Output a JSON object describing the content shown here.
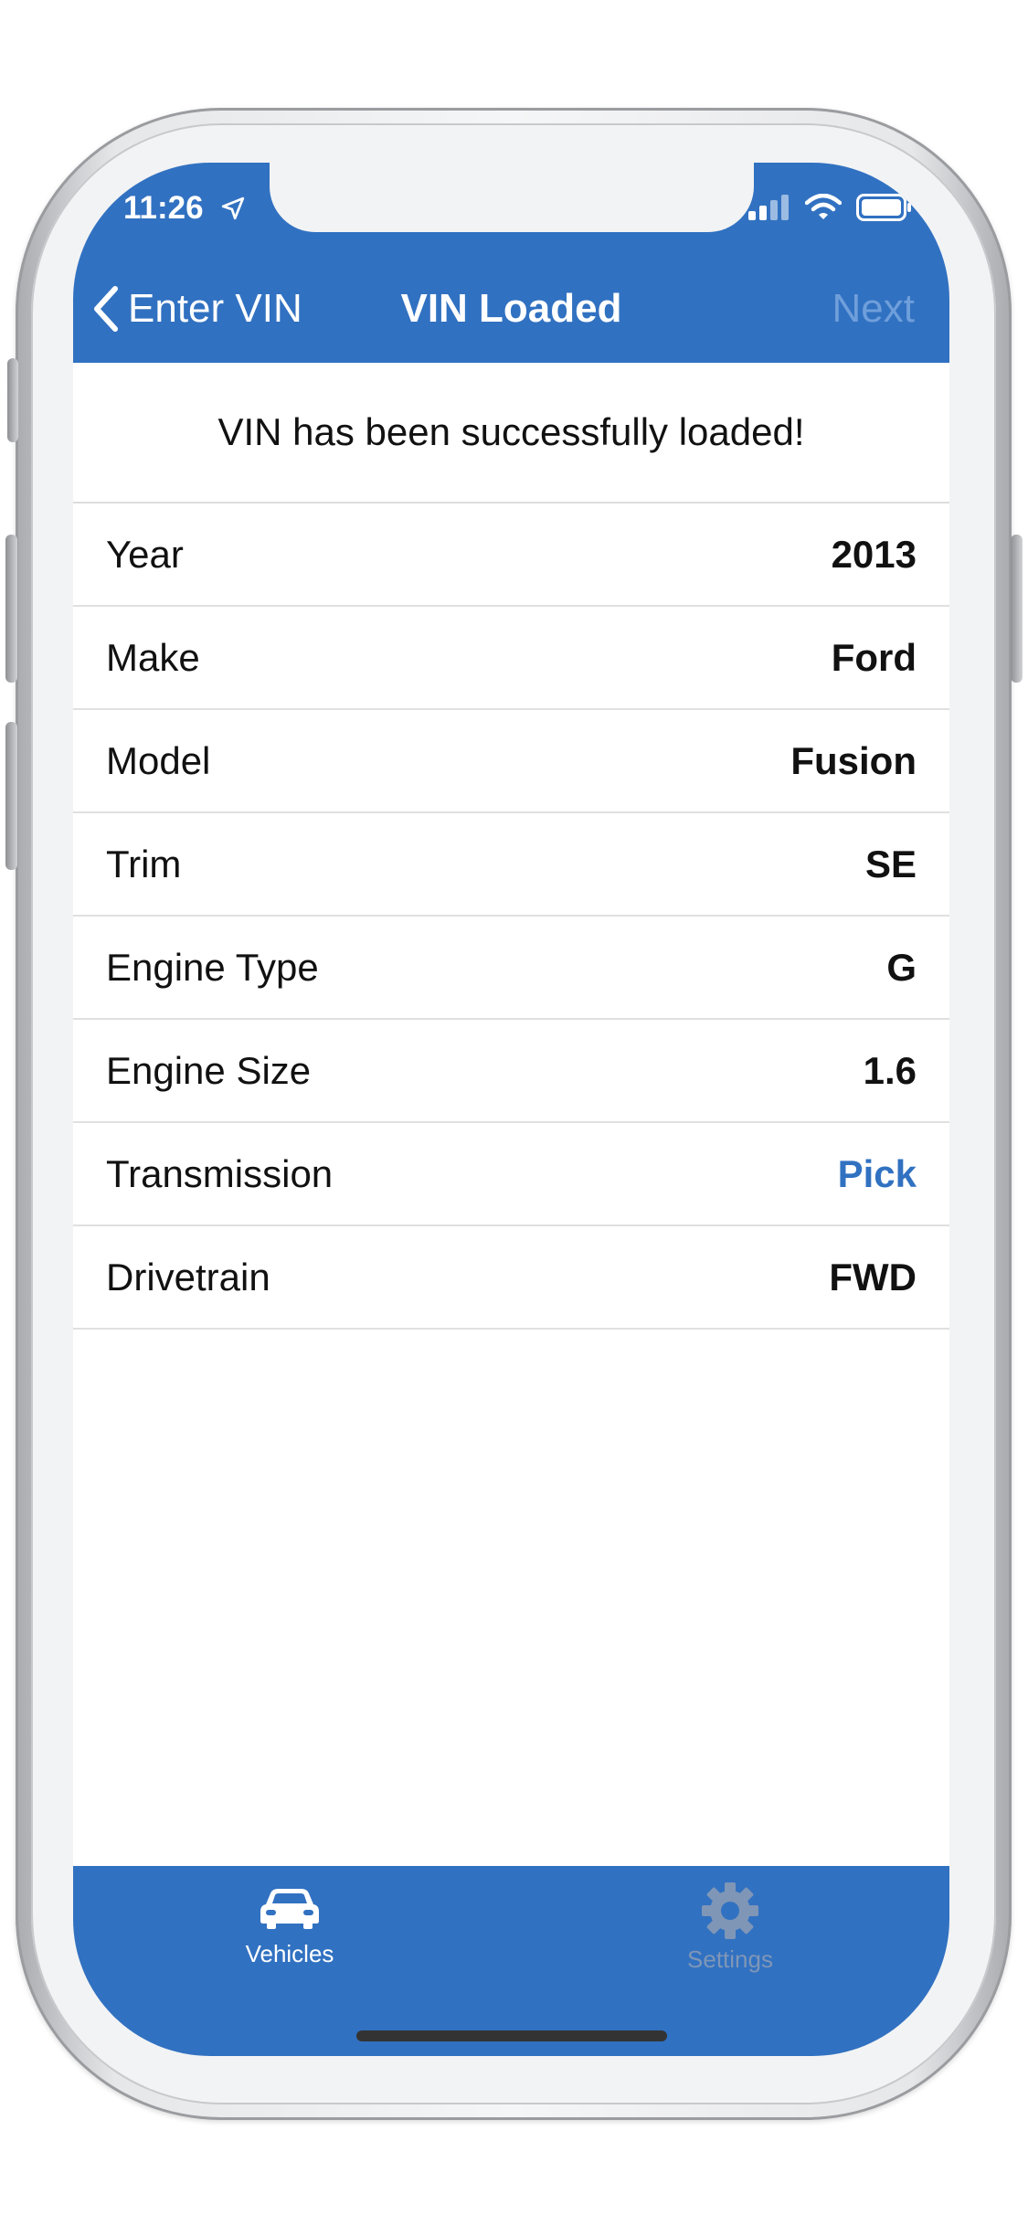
{
  "status_bar": {
    "time": "11:26"
  },
  "nav": {
    "back_label": "Enter VIN",
    "title": "VIN Loaded",
    "next_label": "Next"
  },
  "message": "VIN has been successfully loaded!",
  "rows": [
    {
      "label": "Year",
      "value": "2013"
    },
    {
      "label": "Make",
      "value": "Ford"
    },
    {
      "label": "Model",
      "value": "Fusion"
    },
    {
      "label": "Trim",
      "value": "SE"
    },
    {
      "label": "Engine Type",
      "value": "G"
    },
    {
      "label": "Engine Size",
      "value": "1.6"
    },
    {
      "label": "Transmission",
      "value": "Pick"
    },
    {
      "label": "Drivetrain",
      "value": "FWD"
    }
  ],
  "tabs": [
    {
      "label": "Vehicles",
      "icon": "car-icon",
      "active": true
    },
    {
      "label": "Settings",
      "icon": "gear-icon",
      "active": false
    }
  ],
  "colors": {
    "accent": "#3171c1",
    "link": "#3171c1",
    "disabled": "#6f9fdb",
    "inactive_tab": "#7f96b7"
  }
}
